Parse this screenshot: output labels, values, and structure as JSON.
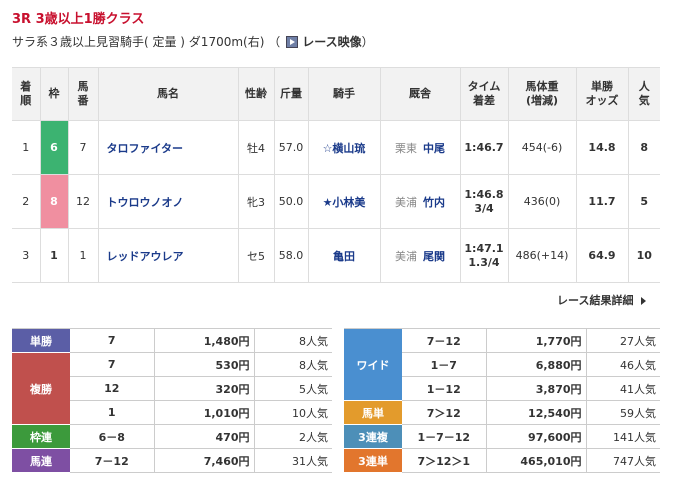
{
  "race": {
    "title": "3R 3歳以上1勝クラス",
    "conditions": "サラ系３歳以上見習騎手( 定量 ) ダ1700m(右) （",
    "video_label": "レース映像",
    "conditions_close": "）"
  },
  "table": {
    "headers": {
      "rank": "着順",
      "waku": "枠",
      "umaban": "馬番",
      "horse": "馬名",
      "sexage": "性齢",
      "weight": "斤量",
      "jockey": "騎手",
      "trainer": "厩舎",
      "time": "タイム着差",
      "body": "馬体重(増減)",
      "odds": "単勝オッズ",
      "pop": "人気"
    },
    "rows": [
      {
        "rank": "1",
        "waku": "6",
        "waku_color": "#3cb371",
        "waku_text": "#ffffff",
        "umaban": "7",
        "horse": "タロファイター",
        "sexage": "牡4",
        "weight": "57.0",
        "jockey": "☆横山琉",
        "aff": "栗東",
        "trainer": "中尾",
        "time": "1:46.7",
        "body": "454(-6)",
        "odds": "14.8",
        "pop": "8"
      },
      {
        "rank": "2",
        "waku": "8",
        "waku_color": "#f08fa0",
        "waku_text": "#ffffff",
        "umaban": "12",
        "horse": "トウロウノオノ",
        "sexage": "牝3",
        "weight": "50.0",
        "jockey": "★小林美",
        "aff": "美浦",
        "trainer": "竹内",
        "time": "1:46.8 3/4",
        "body": "436(0)",
        "odds": "11.7",
        "pop": "5"
      },
      {
        "rank": "3",
        "waku": "1",
        "waku_color": "#ffffff",
        "waku_text": "#333333",
        "umaban": "1",
        "horse": "レッドアウレア",
        "sexage": "セ5",
        "weight": "58.0",
        "jockey": "亀田",
        "aff": "美浦",
        "trainer": "尾関",
        "time": "1:47.1 1.3/4",
        "body": "486(+14)",
        "odds": "64.9",
        "pop": "10"
      }
    ]
  },
  "detail_link": "レース結果詳細",
  "payouts_left": [
    {
      "label": "単勝",
      "color": "#5b5ea6",
      "lines": [
        {
          "num": "7",
          "amt": "1,480円",
          "pop": "8人気"
        }
      ]
    },
    {
      "label": "複勝",
      "color": "#c0504d",
      "lines": [
        {
          "num": "7",
          "amt": "530円",
          "pop": "8人気"
        },
        {
          "num": "12",
          "amt": "320円",
          "pop": "5人気"
        },
        {
          "num": "1",
          "amt": "1,010円",
          "pop": "10人気"
        }
      ]
    },
    {
      "label": "枠連",
      "color": "#3c9a3c",
      "lines": [
        {
          "num": "6－8",
          "amt": "470円",
          "pop": "2人気"
        }
      ]
    },
    {
      "label": "馬連",
      "color": "#7e4fa3",
      "lines": [
        {
          "num": "7－12",
          "amt": "7,460円",
          "pop": "31人気"
        }
      ]
    }
  ],
  "payouts_right": [
    {
      "label": "ワイド",
      "color": "#4a8fd0",
      "lines": [
        {
          "num": "7－12",
          "amt": "1,770円",
          "pop": "27人気"
        },
        {
          "num": "1－7",
          "amt": "6,880円",
          "pop": "46人気"
        },
        {
          "num": "1－12",
          "amt": "3,870円",
          "pop": "41人気"
        }
      ]
    },
    {
      "label": "馬単",
      "color": "#e39b2c",
      "lines": [
        {
          "num": "7＞12",
          "amt": "12,540円",
          "pop": "59人気"
        }
      ]
    },
    {
      "label": "3連複",
      "color": "#4d8fb8",
      "lines": [
        {
          "num": "1－7－12",
          "amt": "97,600円",
          "pop": "141人気"
        }
      ]
    },
    {
      "label": "3連単",
      "color": "#e2762d",
      "lines": [
        {
          "num": "7＞12＞1",
          "amt": "465,010円",
          "pop": "747人気"
        }
      ]
    }
  ]
}
